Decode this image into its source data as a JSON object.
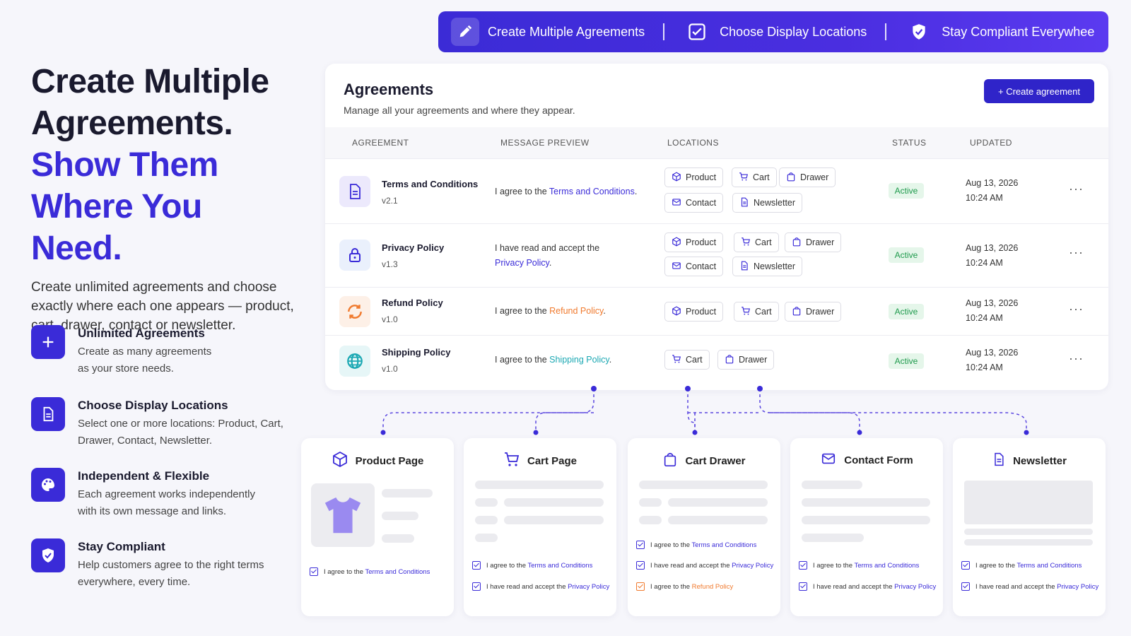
{
  "banner": {
    "items": [
      {
        "label": "Create Multiple Agreements"
      },
      {
        "label": "Choose Display Locations"
      },
      {
        "label": "Stay Compliant Everywhee"
      }
    ]
  },
  "hero": {
    "line1": "Create Multiple",
    "line2": "Agreements.",
    "line3": "Show Them",
    "line4": "Where You Need.",
    "lead": "Create unlimited agreements and choose exactly where each one appears — product, cart, drawer, contact or newsletter."
  },
  "features": [
    {
      "title": "Unlimited Agreements",
      "desc": "Create as many agreements as your store needs."
    },
    {
      "title": "Choose Display Locations",
      "desc": "Select one or more locations: Product, Cart, Drawer, Contact, Newsletter."
    },
    {
      "title": "Independent & Flexible",
      "desc": "Each agreement works independently with its own message and links."
    },
    {
      "title": "Stay Compliant",
      "desc": "Help customers agree to the right terms everywhere, every time."
    }
  ],
  "agreements": {
    "title": "Agreements",
    "subtitle": "Manage all your agreements and where they appear.",
    "create_label": "+ Create agreement",
    "columns": {
      "agreement": "AGREEMENT",
      "preview": "MESSAGE PREVIEW",
      "locations": "LOCATIONS",
      "status": "STATUS",
      "updated": "UPDATED"
    },
    "rows": [
      {
        "name": "Terms and Conditions",
        "version": "v2.1",
        "msg_pre": "I agree to the ",
        "msg_link": "Terms and Conditions",
        "msg_post": ".",
        "status": "Active",
        "date": "Aug 13, 2026",
        "time": "10:24 AM"
      },
      {
        "name": "Privacy Policy",
        "version": "v1.3",
        "msg_pre": "I have read and accept the ",
        "msg_link": "Privacy Policy",
        "msg_post": ".",
        "status": "Active",
        "date": "Aug 13, 2026",
        "time": "10:24 AM"
      },
      {
        "name": "Refund Policy",
        "version": "v1.0",
        "msg_pre": "I agree to the ",
        "msg_link": "Refund Policy",
        "msg_post": ".",
        "status": "Active",
        "date": "Aug 13, 2026",
        "time": "10:24 AM"
      },
      {
        "name": "Shipping Policy",
        "version": "v1.0",
        "msg_pre": "I agree to the ",
        "msg_link": "Shipping Policy",
        "msg_post": ".",
        "status": "Active",
        "date": "Aug 13, 2026",
        "time": "10:24 AM"
      }
    ],
    "chips": {
      "product": "Product",
      "cart": "Cart",
      "drawer": "Drawer",
      "contact": "Contact",
      "newsletter": "Newsletter"
    },
    "more": "···"
  },
  "locations": [
    {
      "title": "Product Page"
    },
    {
      "title": "Cart Page"
    },
    {
      "title": "Cart Drawer"
    },
    {
      "title": "Contact Form"
    },
    {
      "title": "Newsletter"
    }
  ],
  "consent": {
    "agree_pre": "I agree to the ",
    "read_pre": "I have read and accept the ",
    "terms": "Terms and Conditions",
    "privacy": "Privacy Policy",
    "refund": "Refund Policy"
  },
  "colors": {
    "accent": "#3a2bd8",
    "orange": "#f07a2e",
    "teal": "#1ba8b3",
    "active": "#1e9a4c"
  }
}
